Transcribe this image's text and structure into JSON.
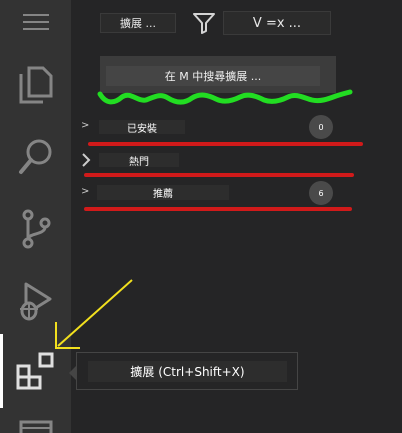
{
  "header": {
    "left_button_label": "擴展 ...",
    "right_button_label": "V =x ...",
    "filter_icon": "filter-icon"
  },
  "search": {
    "label": "在 M 中搜尋擴展 ..."
  },
  "sections": [
    {
      "label": "已安裝",
      "badge": "0"
    },
    {
      "label": "熱門"
    },
    {
      "label": "推薦",
      "badge": "6"
    }
  ],
  "activity_bar": {
    "items": [
      "menu-icon",
      "explorer-icon",
      "search-icon",
      "source-control-icon",
      "run-debug-icon",
      "extensions-icon",
      "panel-icon"
    ]
  },
  "tooltip": {
    "text": "擴展 (Ctrl+Shift+X)"
  },
  "colors": {
    "activity_bar": "#333333",
    "sidebar": "#252526",
    "annotation_green": "#22dd22",
    "annotation_red": "#d11a1a",
    "annotation_yellow": "#f2e01e"
  }
}
